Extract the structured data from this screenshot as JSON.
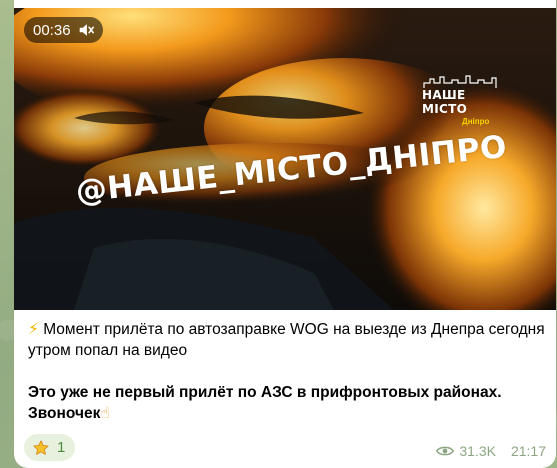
{
  "video": {
    "duration": "00:36",
    "watermark": "@НАШЕ_МІСТО_ДНІПРО",
    "logo_title": "НАШЕ МІСТО",
    "logo_sub": "Дніпро",
    "progress": 0.21
  },
  "message": {
    "bolt_icon": "⚡",
    "line1": "Момент прилёта по автозаправке WOG на выезде из Днепра сегодня утром попал на видео",
    "line2": "Это уже не первый прилёт по АЗС в прифронтовых районах. Звоночек",
    "hand_icon": "☝"
  },
  "reaction": {
    "emoji": "star-icon",
    "count": "1"
  },
  "meta": {
    "views": "31.3K",
    "time": "21:17"
  },
  "colors": {
    "accent": "#4fa3e8",
    "meta": "#8ca681",
    "reaction_bg": "#e8f1de",
    "reaction_text": "#4d8a3c"
  }
}
